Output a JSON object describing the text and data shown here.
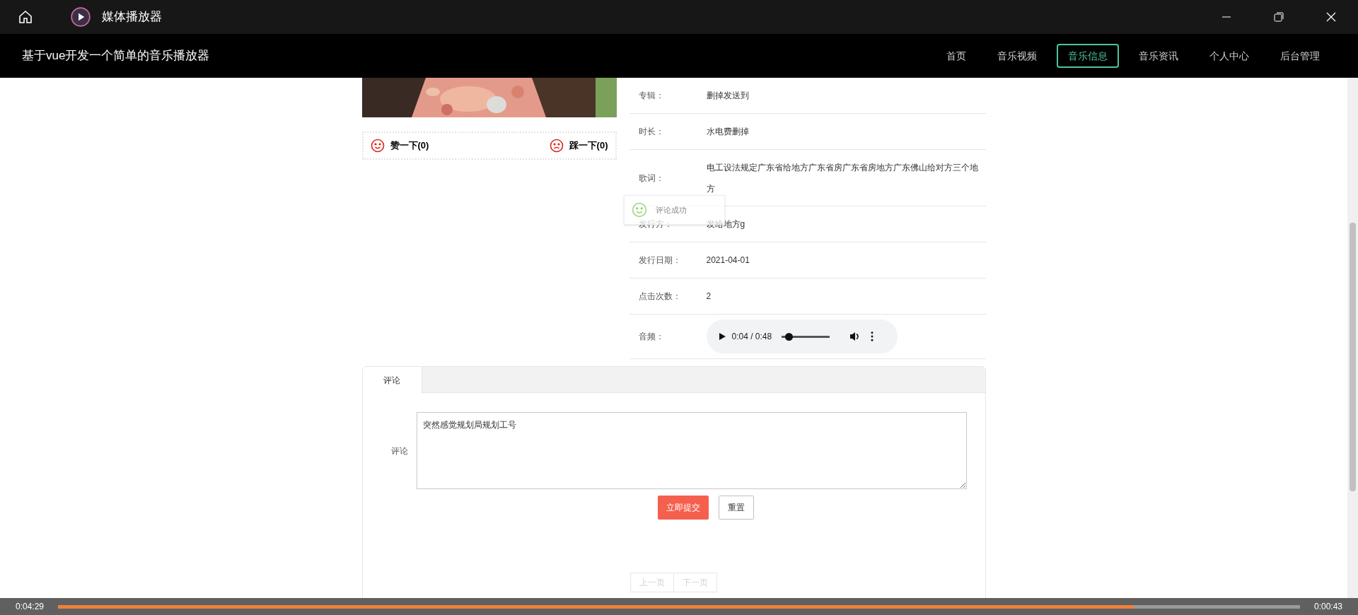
{
  "window": {
    "title": "媒体播放器"
  },
  "navbar": {
    "brand": "基于vue开发一个简单的音乐播放器",
    "items": [
      {
        "label": "首页",
        "selected": false
      },
      {
        "label": "音乐视频",
        "selected": false
      },
      {
        "label": "音乐信息",
        "selected": true
      },
      {
        "label": "音乐资讯",
        "selected": false
      },
      {
        "label": "个人中心",
        "selected": false
      },
      {
        "label": "后台管理",
        "selected": false
      }
    ]
  },
  "reactions": [
    {
      "kind": "like",
      "label": "赞一下(0)"
    },
    {
      "kind": "dislike",
      "label": "踩一下(0)"
    }
  ],
  "details": [
    {
      "kind": "text",
      "label": "专辑：",
      "value": "删掉发送到"
    },
    {
      "kind": "text",
      "label": "时长：",
      "value": "水电费删掉"
    },
    {
      "kind": "text",
      "label": "歌词：",
      "value": "电工设法规定广东省给地方广东省房广东省房地方广东佛山给对方三个地方"
    },
    {
      "kind": "text",
      "label": "发行方：",
      "value": "发给地方g"
    },
    {
      "kind": "text",
      "label": "发行日期：",
      "value": "2021-04-01"
    },
    {
      "kind": "text",
      "label": "点击次数：",
      "value": "2"
    },
    {
      "kind": "audio",
      "label": "音频：",
      "time": "0:04 / 0:48",
      "level": 0.15
    }
  ],
  "toast": {
    "message": "评论成功"
  },
  "comments": {
    "tabs": [
      {
        "label": "评论",
        "selected": true
      }
    ],
    "field_label": "评论",
    "value": "突然感觉规划局规划工号",
    "buttons": [
      {
        "label": "立即提交",
        "kind": "primary"
      },
      {
        "label": "重置",
        "kind": "default"
      }
    ],
    "pagination": [
      {
        "label": "上一页",
        "disabled": true
      },
      {
        "label": "下一页",
        "disabled": true
      }
    ]
  },
  "player": {
    "elapsed": "0:04:29",
    "remaining": "0:00:43",
    "level": 0.866
  }
}
